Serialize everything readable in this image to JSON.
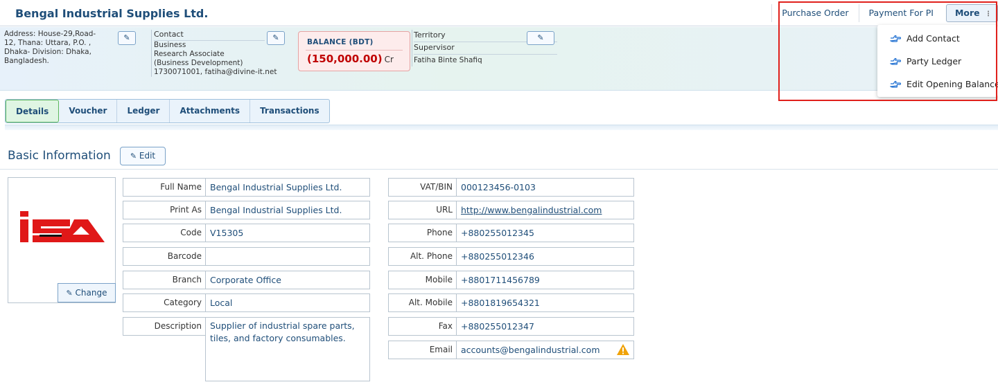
{
  "header": {
    "title": "Bengal Industrial Supplies Ltd.",
    "actions": [
      "Purchase Order",
      "Payment For PI"
    ],
    "more_label": "More"
  },
  "more_menu": {
    "items": [
      "Add Contact",
      "Party Ledger",
      "Edit Opening Balance"
    ]
  },
  "party": {
    "address_lines": [
      "Address: House-29,Road-",
      "12, Thana: Uttara, P.O. ,",
      "Dhaka- Division: Dhaka,",
      "Bangladesh."
    ],
    "contact_label": "Contact",
    "contact_lines": [
      "Business",
      "Research Associate",
      "(Business Development)",
      "1730071001, fatiha@divine-it.net"
    ],
    "balance_label": "BALANCE (BDT)",
    "balance_value": "(150,000.00)",
    "balance_unit": "Cr",
    "territory_label": "Territory",
    "supervisor_label": "Supervisor",
    "supervisor_value": "Fatiha Binte Shafiq"
  },
  "tabs": [
    "Details",
    "Voucher",
    "Ledger",
    "Attachments",
    "Transactions"
  ],
  "basic_info": {
    "title": "Basic Information",
    "edit_label": "Edit",
    "change_label": "Change",
    "left_fields": [
      {
        "label": "Full Name",
        "value": "Bengal Industrial Supplies Ltd."
      },
      {
        "label": "Print As",
        "value": "Bengal Industrial Supplies Ltd."
      },
      {
        "label": "Code",
        "value": "V15305"
      },
      {
        "label": "Barcode",
        "value": ""
      },
      {
        "label": "Branch",
        "value": "Corporate Office"
      },
      {
        "label": "Category",
        "value": "Local"
      },
      {
        "label": "Description",
        "value": "Supplier of industrial spare parts, tiles, and factory consumables."
      }
    ],
    "right_fields": [
      {
        "label": "VAT/BIN",
        "value": "000123456-0103"
      },
      {
        "label": "URL",
        "value": "http://www.bengalindustrial.com"
      },
      {
        "label": "Phone",
        "value": "+880255012345"
      },
      {
        "label": "Alt. Phone",
        "value": "+880255012346"
      },
      {
        "label": "Mobile",
        "value": "+8801711456789"
      },
      {
        "label": "Alt. Mobile",
        "value": "+8801819654321"
      },
      {
        "label": "Fax",
        "value": "+880255012347"
      },
      {
        "label": "Email",
        "value": "accounts@bengalindustrial.com"
      }
    ]
  },
  "colors": {
    "accent": "#1f4e79",
    "balance_red": "#c00000",
    "highlight": "#e0201b",
    "logo_red": "#e01818"
  },
  "icons": [
    "edit-icon",
    "pencil-icon",
    "hand-point-right-icon",
    "warning-icon",
    "more-dots-icon"
  ]
}
